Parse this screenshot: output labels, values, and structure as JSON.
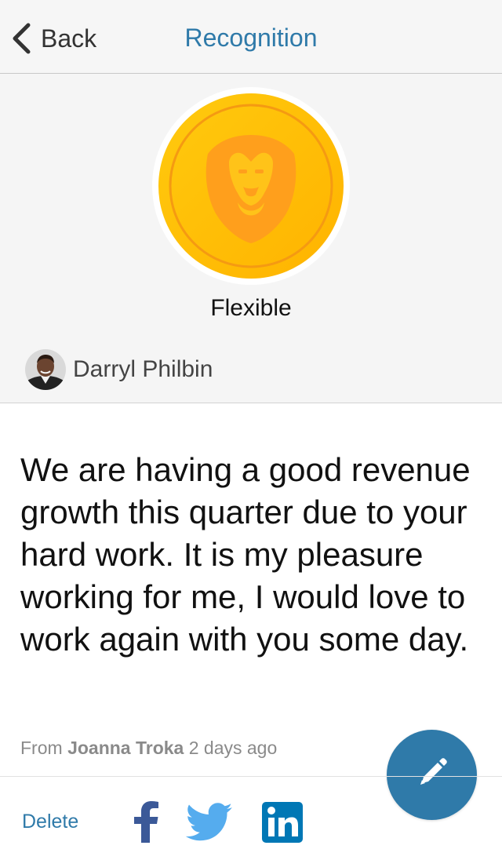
{
  "navbar": {
    "back_label": "Back",
    "title": "Recognition",
    "back_icon": "chevron-left-icon"
  },
  "badge": {
    "label": "Flexible",
    "icon": "lion-icon",
    "colors": {
      "outer": "#ffc107",
      "inner": "#ffcc0a",
      "accent": "#ff9f1c"
    }
  },
  "sender": {
    "name": "Darryl Philbin"
  },
  "message": {
    "text": "We are having a good revenue growth this quarter due to your hard work. It is my pleasure working for me, I would love to work again with you some day."
  },
  "meta": {
    "from_prefix": "From",
    "author": "Joanna Troka",
    "time": "2 days ago"
  },
  "actions": {
    "delete_label": "Delete",
    "edit_icon": "pencil-icon",
    "share_icons": [
      "facebook-icon",
      "twitter-icon",
      "linkedin-icon"
    ]
  },
  "colors": {
    "accent": "#2f7aa9",
    "facebook": "#3b5998",
    "twitter": "#55acee",
    "linkedin": "#0077b5"
  }
}
